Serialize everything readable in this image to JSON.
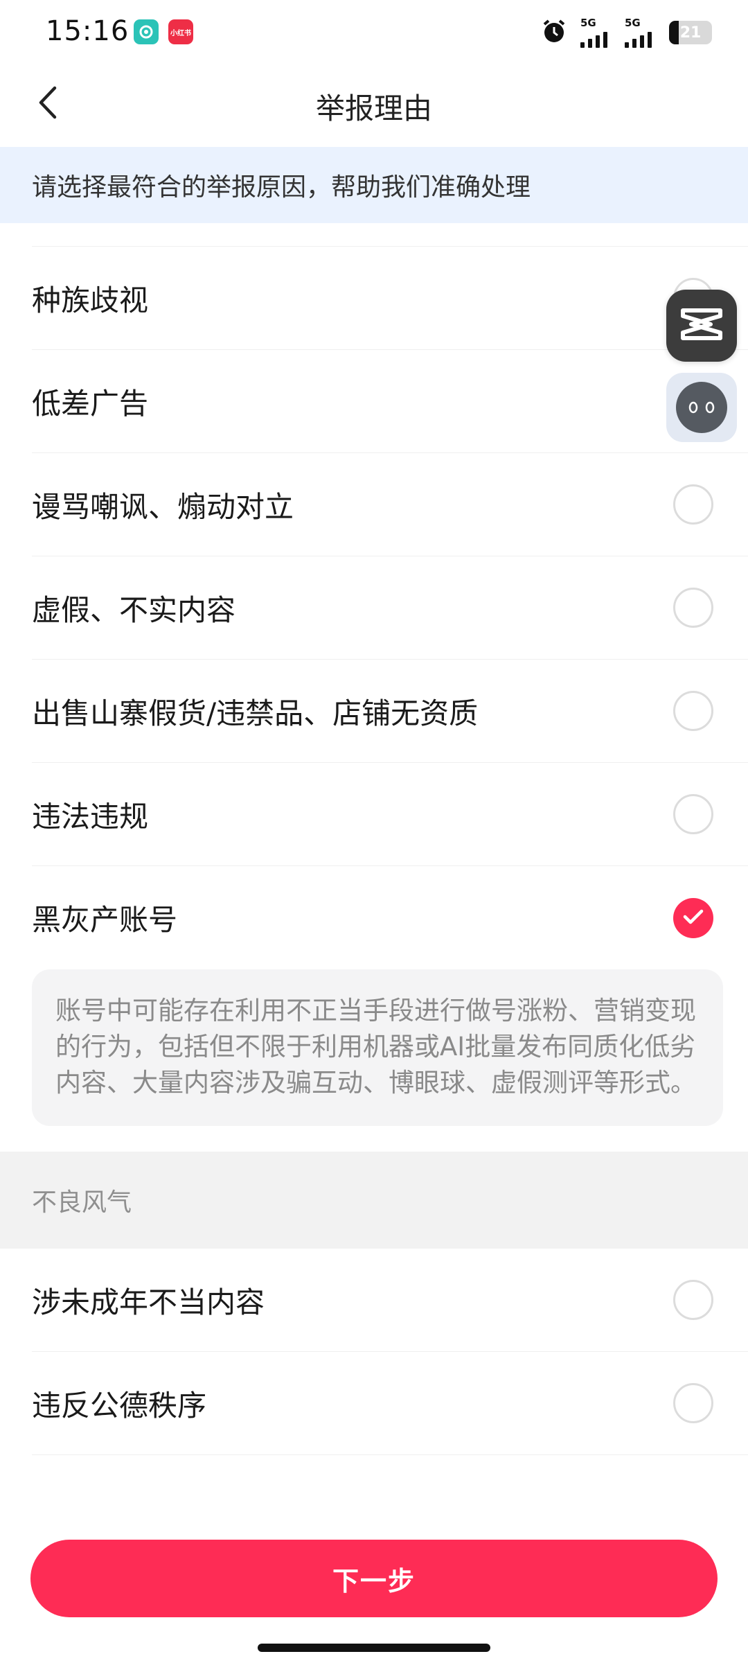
{
  "status_bar": {
    "time": "15:16",
    "app_badge_1": "",
    "app_badge_2": "小红书",
    "signal_1_label": "5G",
    "signal_2_label": "5G",
    "battery_level": "21"
  },
  "header": {
    "title": "举报理由"
  },
  "notice": {
    "text": "请选择最符合的举报原因，帮助我们准确处理"
  },
  "reasons": [
    {
      "label": "种族歧视",
      "selected": false
    },
    {
      "label": "低差广告",
      "selected": false
    },
    {
      "label": "谩骂嘲讽、煽动对立",
      "selected": false
    },
    {
      "label": "虚假、不实内容",
      "selected": false
    },
    {
      "label": "出售山寨假货/违禁品、店铺无资质",
      "selected": false
    },
    {
      "label": "违法违规",
      "selected": false
    },
    {
      "label": "黑灰产账号",
      "selected": true
    }
  ],
  "selected_description": "账号中可能存在利用不正当手段进行做号涨粉、营销变现的行为，包括但不限于利用机器或AI批量发布同质化低劣内容、大量内容涉及骗互动、博眼球、虚假测评等形式。",
  "section_2": {
    "title": "不良风气",
    "items": [
      {
        "label": "涉未成年不当内容",
        "selected": false
      },
      {
        "label": "违反公德秩序",
        "selected": false
      }
    ]
  },
  "footer": {
    "next_button": "下一步"
  },
  "colors": {
    "accent": "#fe2c55",
    "notice_bg": "#eaf2fe",
    "section_bg": "#f2f2f2"
  },
  "icons": {
    "back": "chevron-left-icon",
    "check": "check-icon",
    "capcut": "capcut-icon",
    "assistant": "assistant-icon",
    "alarm": "alarm-icon"
  }
}
